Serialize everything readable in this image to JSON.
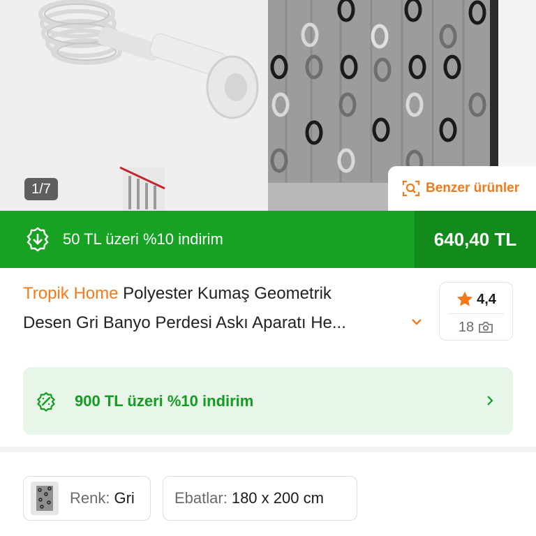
{
  "gallery": {
    "counter": "1/7",
    "similar_label": "Benzer ürünler"
  },
  "promo": {
    "text": "50 TL üzeri %10 indirim",
    "price": "640,40 TL"
  },
  "product": {
    "brand": "Tropik Home",
    "title_line1": " Polyester Kumaş Geometrik",
    "title_line2": "Desen Gri Banyo Perdesi Askı Aparatı He..."
  },
  "rating": {
    "score": "4,4",
    "photo_count": "18"
  },
  "discount_card": {
    "text": "900 TL üzeri %10 indirim"
  },
  "variants": {
    "color_label": "Renk:",
    "color_value": "Gri",
    "size_label": "Ebatlar:",
    "size_value": "180 x 200 cm"
  },
  "colors": {
    "brand_orange": "#f27a1a",
    "promo_green": "#17a223",
    "promo_green_dark": "#128a1c",
    "card_green_bg": "#e7f6e8",
    "card_green_text": "#139b22"
  },
  "icons": [
    "find-similar-icon",
    "discount-badge-icon",
    "star-icon",
    "camera-icon",
    "chevron-down-icon",
    "chevron-right-icon"
  ]
}
